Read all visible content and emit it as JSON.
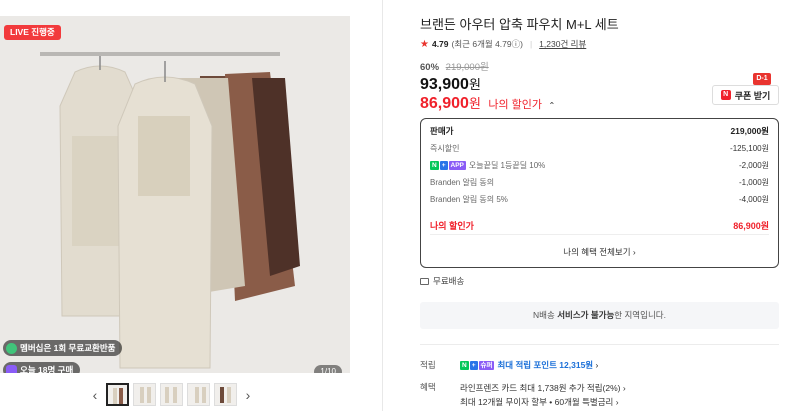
{
  "gallery": {
    "live_badge": "LIVE 진행중",
    "membership_pill": "멤버십은 1회 무료교환반품",
    "buyers_pill": "오늘 18명 구매",
    "counter": "1/10",
    "prev_arrow": "‹",
    "next_arrow": "›",
    "thumb_count": 5
  },
  "product": {
    "title": "브랜든 아우터 압축 파우치 M+L 세트",
    "rating": "4.79",
    "rating_detail": "(최근 6개월 4.79ⓘ)",
    "reviews": "1,230건 리뷰",
    "discount_pct": "60%",
    "original_price": "219,000원",
    "price": "93,900",
    "price_unit": "원",
    "my_price": "86,900",
    "my_price_unit": "원",
    "my_price_label": "나의 할인가",
    "my_price_chevron": "⌃",
    "coupon_label": "쿠폰 받기",
    "coupon_icon": "N",
    "coupon_dday": "D-1"
  },
  "breakdown": {
    "rows": [
      {
        "label": "판매가",
        "value": "219,000원"
      },
      {
        "label": "즉시할인",
        "value": "-125,100원"
      },
      {
        "label": "오늘끝딜 1등끝딜 10%",
        "value": "-2,000원"
      },
      {
        "label": "Branden 알림 동의",
        "value": "-1,000원"
      },
      {
        "label": "Branden 알림 동의 5%",
        "value": "-4,000원"
      }
    ],
    "tags": {
      "n": "N",
      "plus": "+",
      "app": "APP"
    },
    "total_label": "나의 할인가",
    "total_value": "86,900원",
    "benefit_link": "나의 혜택 전체보기 ›"
  },
  "shipping": {
    "label": "무료배송",
    "notice_prefix": "N배송 ",
    "notice_bold": "서비스가 불가능",
    "notice_suffix": "한 지역입니다."
  },
  "points": {
    "key": "적립",
    "tag_ur": "슈퍼",
    "text": "최대 적립 포인트 12,315원",
    "chevron": "›"
  },
  "benefits": {
    "key": "혜택",
    "line1": "라인프렌즈 카드 최대 1,738원 추가 적립(2%) ›",
    "line2": "최대 12개월 무이자 할부 • 60개월 특별금리 ›"
  },
  "colors": {
    "accent_red": "#f0212b",
    "naver_green": "#03c75a",
    "point_blue": "#1a6fd8"
  }
}
